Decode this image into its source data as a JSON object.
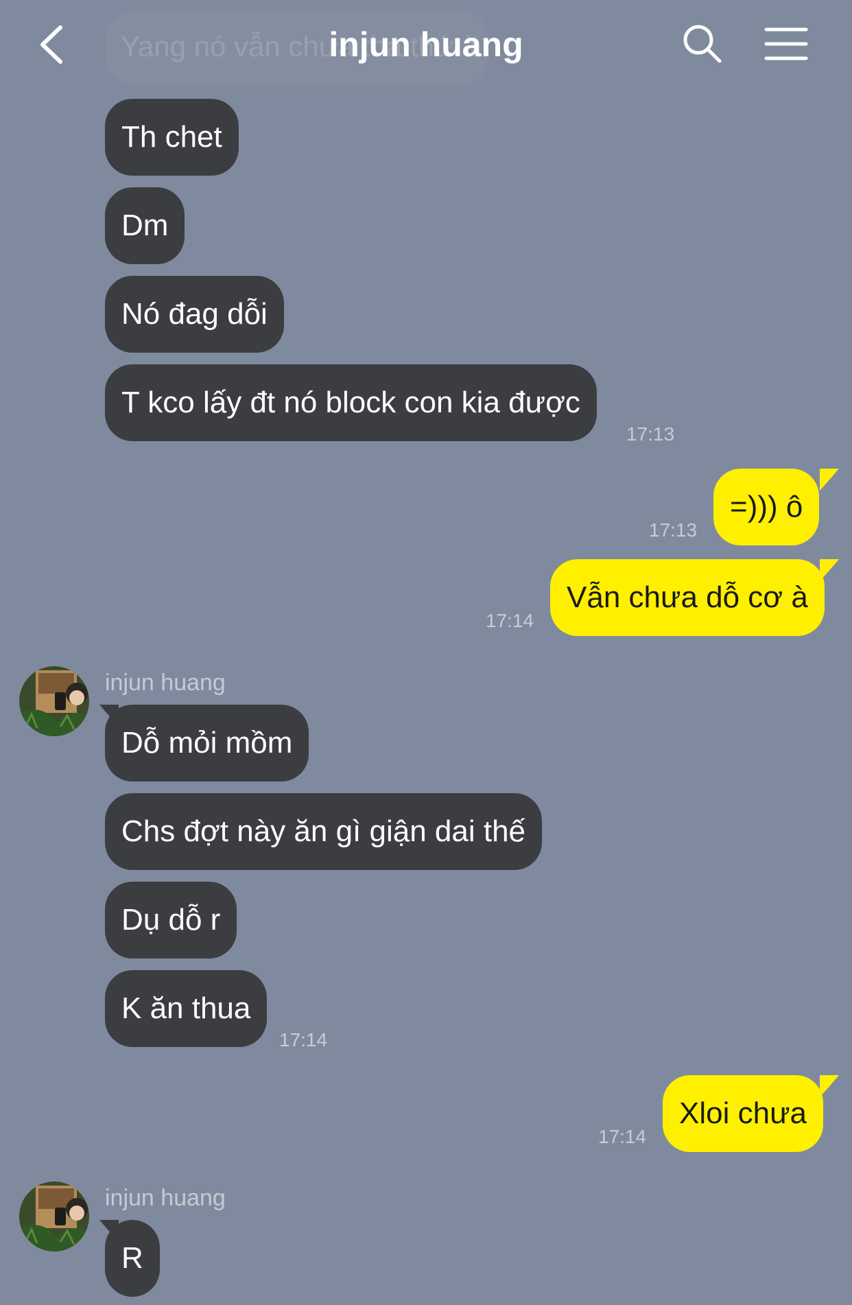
{
  "header": {
    "title": "injun huang",
    "ghost_text": "Yang nó vẫn chưa tha thứ à"
  },
  "messages": [
    {
      "id": "m1",
      "side": "in",
      "text": "Th chet"
    },
    {
      "id": "m2",
      "side": "in",
      "text": "Dm"
    },
    {
      "id": "m3",
      "side": "in",
      "text": "Nó đag dỗi"
    },
    {
      "id": "m4",
      "side": "in",
      "text": "T kco lấy đt nó block con kia được",
      "time": "17:13"
    },
    {
      "id": "m5",
      "side": "out",
      "text": "=))) ô",
      "time": "17:13"
    },
    {
      "id": "m6",
      "side": "out",
      "text": "Vẫn chưa dỗ cơ à",
      "time": "17:14"
    },
    {
      "id": "m7",
      "side": "in",
      "sender": "injun huang",
      "text": "Dỗ mỏi mồm"
    },
    {
      "id": "m8",
      "side": "in",
      "text": "Chs đợt này ăn gì giận dai thế"
    },
    {
      "id": "m9",
      "side": "in",
      "text": "Dụ dỗ r"
    },
    {
      "id": "m10",
      "side": "in",
      "text": "K ăn thua",
      "time": "17:14"
    },
    {
      "id": "m11",
      "side": "out",
      "text": "Xloi chưa",
      "time": "17:14"
    },
    {
      "id": "m12",
      "side": "in",
      "sender": "injun huang",
      "text": "R"
    }
  ],
  "colors": {
    "background": "#808a9e",
    "incoming_bubble": "#3b3d41",
    "outgoing_bubble": "#fff000"
  },
  "icons": [
    "back-arrow-icon",
    "search-icon",
    "menu-icon",
    "avatar"
  ]
}
